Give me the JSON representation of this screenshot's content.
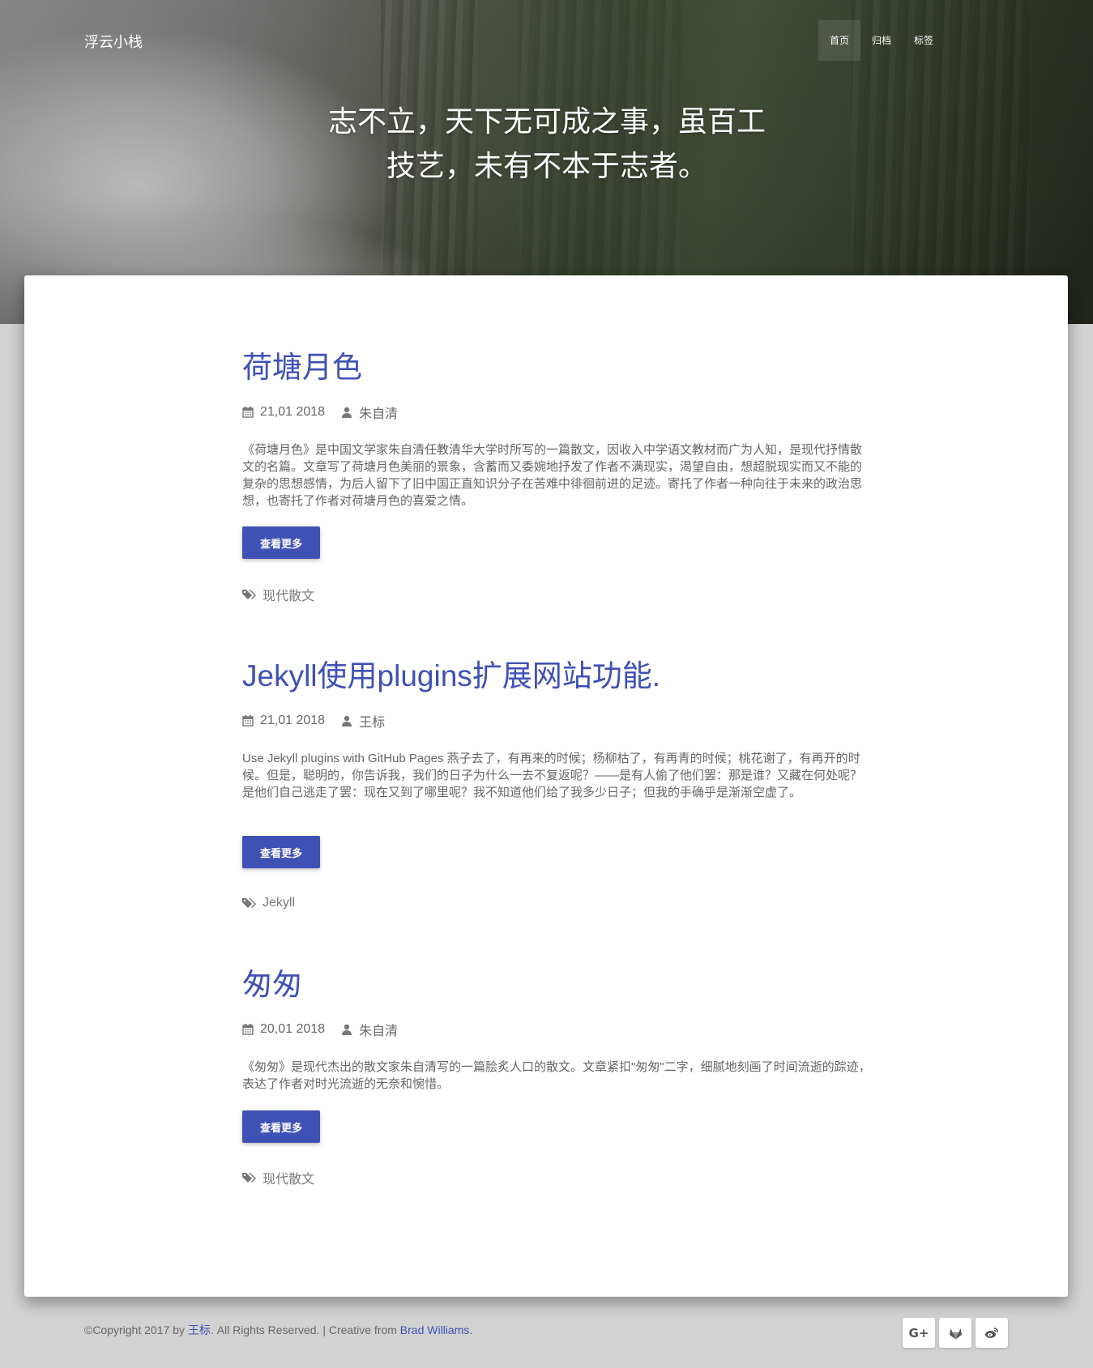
{
  "site": {
    "brand": "浮云小栈",
    "nav": [
      {
        "label": "首页",
        "active": true
      },
      {
        "label": "归档",
        "active": false
      },
      {
        "label": "标签",
        "active": false
      }
    ],
    "quote_line1": "志不立，天下无可成之事，虽百工",
    "quote_line2": "技艺，未有不本于志者。"
  },
  "posts": [
    {
      "title": "荷塘月色",
      "date": "21,01 2018",
      "author": "朱自清",
      "excerpt": "《荷塘月色》是中国文学家朱自清任教清华大学时所写的一篇散文，因收入中学语文教材而广为人知，是现代抒情散文的名篇。文章写了荷塘月色美丽的景象，含蓄而又委婉地抒发了作者不满现实，渴望自由，想超脱现实而又不能的复杂的思想感情，为后人留下了旧中国正直知识分子在苦难中徘徊前进的足迹。寄托了作者一种向往于未来的政治思想，也寄托了作者对荷塘月色的喜爱之情。",
      "button": "查看更多",
      "tag": "现代散文"
    },
    {
      "title": "Jekyll使用plugins扩展网站功能.",
      "date": "21,01 2018",
      "author": "王标",
      "excerpt": "Use Jekyll plugins with GitHub Pages 燕子去了，有再来的时候；杨柳枯了，有再青的时候；桃花谢了，有再开的时候。但是，聪明的，你告诉我，我们的日子为什么一去不复返呢？——是有人偷了他们罢：那是谁？又藏在何处呢？是他们自己逃走了罢：现在又到了哪里呢？我不知道他们给了我多少日子；但我的手确乎是渐渐空虚了。",
      "button": "查看更多",
      "tag": "Jekyll"
    },
    {
      "title": "匆匆",
      "date": "20,01 2018",
      "author": "朱自清",
      "excerpt": "《匆匆》是现代杰出的散文家朱自清写的一篇脍炙人口的散文。文章紧扣\"匆匆\"二字，细腻地刻画了时间流逝的踪迹，表达了作者对时光流逝的无奈和惋惜。",
      "button": "查看更多",
      "tag": "现代散文"
    }
  ],
  "footer": {
    "prefix": "©Copyright 2017 by ",
    "author_link": "王标",
    "middle": ". All Rights Reserved. | Creative from ",
    "creator_link": "Brad Williams",
    "suffix": ".",
    "social": [
      {
        "icon": "google-plus-icon",
        "glyph": "G+"
      },
      {
        "icon": "gitlab-icon",
        "glyph": ""
      },
      {
        "icon": "weibo-icon",
        "glyph": ""
      }
    ]
  },
  "colors": {
    "accent": "#3f51b5",
    "page_bg": "#d2d2d2",
    "text_muted": "#666666"
  }
}
